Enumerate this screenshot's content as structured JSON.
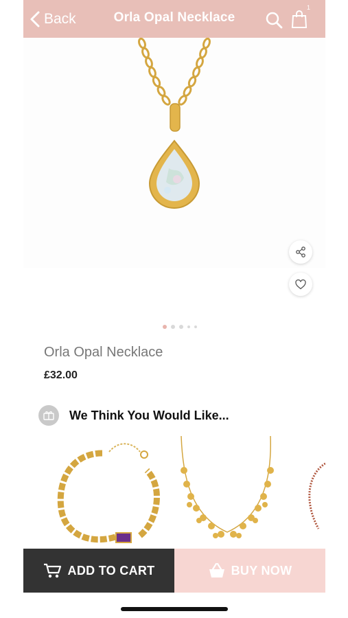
{
  "header": {
    "back_label": "Back",
    "title": "Orla Opal Necklace",
    "cart_count": "1",
    "background": "#e8bfb8"
  },
  "gallery": {
    "image_alt": "gold teardrop opal pendant necklace",
    "slides": 5,
    "active_slide": 1
  },
  "product": {
    "name": "Orla Opal Necklace",
    "price": "£32.00"
  },
  "recommendations": {
    "title": "We Think You Would Like...",
    "items": [
      {
        "image": "gold chain bracelet with purple stone"
      },
      {
        "image": "gold necklace with disc charms"
      },
      {
        "image": "beaded bracelet (partially visible)"
      }
    ]
  },
  "actions": {
    "add_to_cart_label": "ADD TO CART",
    "buy_now_label": "BUY NOW",
    "cart_color": "#333333",
    "buy_color": "#f7d6d2"
  }
}
